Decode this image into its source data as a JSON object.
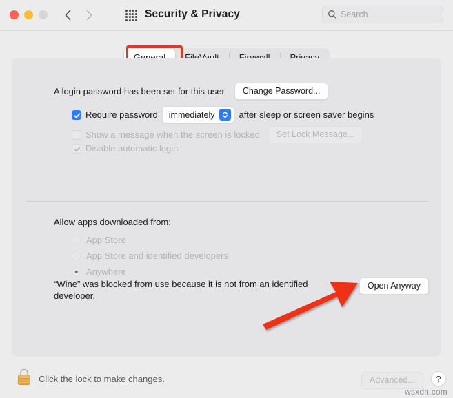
{
  "window": {
    "title": "Security & Privacy",
    "traffic_lights": [
      "close",
      "minimize",
      "zoom"
    ],
    "back_icon": "chevron-left-icon",
    "forward_icon": "chevron-right-icon",
    "grid_icon": "grid-apps-icon"
  },
  "search": {
    "placeholder": "Search",
    "value": "",
    "icon": "search-icon"
  },
  "tabs": [
    {
      "label": "General",
      "selected": true
    },
    {
      "label": "FileVault",
      "selected": false
    },
    {
      "label": "Firewall",
      "selected": false
    },
    {
      "label": "Privacy",
      "selected": false
    }
  ],
  "general": {
    "login_password_text": "A login password has been set for this user",
    "change_password_button": "Change Password...",
    "require_password": {
      "checked": true,
      "label": "Require password",
      "delay_value": "immediately",
      "suffix": "after sleep or screen saver begins"
    },
    "show_message": {
      "checked": false,
      "disabled": true,
      "label": "Show a message when the screen is locked",
      "button": "Set Lock Message..."
    },
    "disable_auto_login": {
      "checked": true,
      "disabled": true,
      "label": "Disable automatic login"
    },
    "allow_apps_heading": "Allow apps downloaded from:",
    "allow_apps_options": [
      {
        "label": "App Store",
        "selected": false
      },
      {
        "label": "App Store and identified developers",
        "selected": false
      },
      {
        "label": "Anywhere",
        "selected": true
      }
    ],
    "blocked_message": "“Wine” was blocked from use because it is not from an identified developer.",
    "open_anyway_button": "Open Anyway"
  },
  "bottom": {
    "lock_icon": "locked-padlock-icon",
    "lock_text": "Click the lock to make changes.",
    "advanced_button": "Advanced...",
    "advanced_disabled": true,
    "help_button": "?"
  },
  "annotations": {
    "highlight_target": "General",
    "arrow_target": "Open Anyway",
    "color": "#e8351c"
  },
  "watermark": "wsxdn.com",
  "colors": {
    "accent": "#2f7cf6",
    "annotation": "#e8351c",
    "window_bg": "#ececec",
    "panel_bg": "#e4e4e6"
  }
}
